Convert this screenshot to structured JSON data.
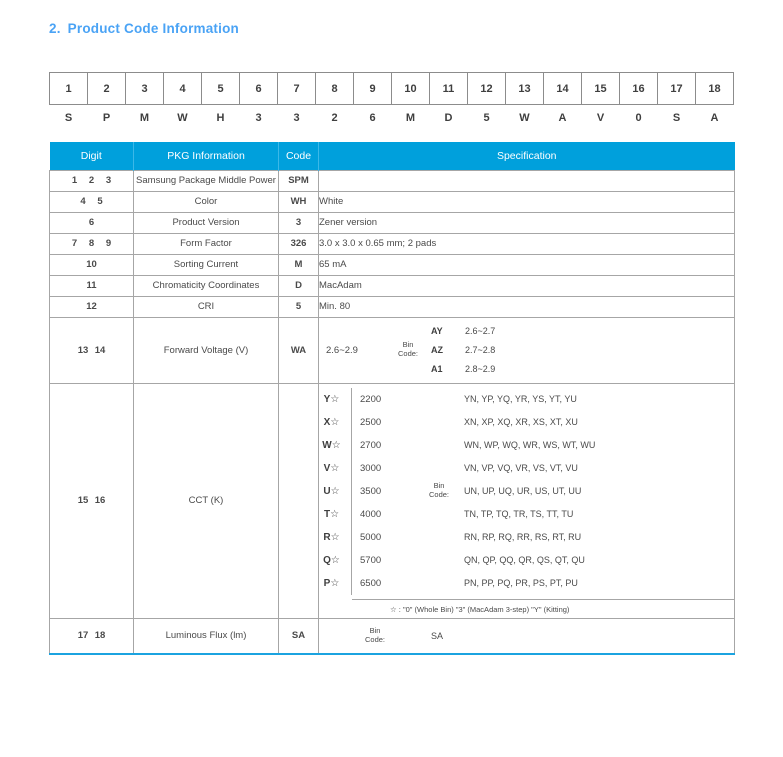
{
  "section": {
    "number": "2.",
    "title": "Product Code Information"
  },
  "code_strip": {
    "positions": [
      "1",
      "2",
      "3",
      "4",
      "5",
      "6",
      "7",
      "8",
      "9",
      "10",
      "11",
      "12",
      "13",
      "14",
      "15",
      "16",
      "17",
      "18"
    ],
    "letters": [
      "S",
      "P",
      "M",
      "W",
      "H",
      "3",
      "3",
      "2",
      "6",
      "M",
      "D",
      "5",
      "W",
      "A",
      "V",
      "0",
      "S",
      "A"
    ]
  },
  "table": {
    "headers": {
      "digit": "Digit",
      "pkg": "PKG Information",
      "code": "Code",
      "specification": "Specification"
    },
    "rows": [
      {
        "digits": [
          "1",
          "2",
          "3"
        ],
        "pkg": "Samsung Package Middle Power",
        "code": "SPM",
        "spec": ""
      },
      {
        "digits": [
          "4",
          "5"
        ],
        "pkg": "Color",
        "code": "WH",
        "spec": "White"
      },
      {
        "digits": [
          "6"
        ],
        "pkg": "Product Version",
        "code": "3",
        "spec": "Zener version"
      },
      {
        "digits": [
          "7",
          "8",
          "9"
        ],
        "pkg": "Form Factor",
        "code": "326",
        "spec": "3.0 x 3.0 x 0.65 mm;   2 pads"
      },
      {
        "digits": [
          "10"
        ],
        "pkg": "Sorting Current",
        "code": "M",
        "spec": "65 mA"
      },
      {
        "digits": [
          "11"
        ],
        "pkg": "Chromaticity Coordinates",
        "code": "D",
        "spec": "MacAdam"
      },
      {
        "digits": [
          "12"
        ],
        "pkg": "CRI",
        "code": "5",
        "spec": "Min. 80"
      }
    ],
    "forward_voltage": {
      "digits": [
        "13",
        "14"
      ],
      "pkg": "Forward Voltage (V)",
      "code": "WA",
      "range": "2.6~2.9",
      "bin_label_line1": "Bin",
      "bin_label_line2": "Code:",
      "bins": [
        {
          "code": "AY",
          "value": "2.6~2.7"
        },
        {
          "code": "AZ",
          "value": "2.7~2.8"
        },
        {
          "code": "A1",
          "value": "2.8~2.9"
        }
      ]
    },
    "cct": {
      "digits": [
        "15",
        "16"
      ],
      "pkg": "CCT (K)",
      "bin_label_line1": "Bin",
      "bin_label_line2": "Code:",
      "star": "☆",
      "rows": [
        {
          "code": "Y",
          "kelvin": "2200",
          "bins": "YN, YP, YQ, YR, YS, YT, YU"
        },
        {
          "code": "X",
          "kelvin": "2500",
          "bins": "XN, XP, XQ, XR, XS, XT, XU"
        },
        {
          "code": "W",
          "kelvin": "2700",
          "bins": "WN, WP, WQ, WR, WS, WT, WU"
        },
        {
          "code": "V",
          "kelvin": "3000",
          "bins": "VN, VP, VQ, VR, VS, VT, VU"
        },
        {
          "code": "U",
          "kelvin": "3500",
          "bins": "UN, UP, UQ, UR, US, UT, UU"
        },
        {
          "code": "T",
          "kelvin": "4000",
          "bins": "TN, TP, TQ, TR, TS, TT, TU"
        },
        {
          "code": "R",
          "kelvin": "5000",
          "bins": "RN, RP, RQ, RR, RS, RT, RU"
        },
        {
          "code": "Q",
          "kelvin": "5700",
          "bins": "QN, QP, QQ, QR, QS, QT, QU"
        },
        {
          "code": "P",
          "kelvin": "6500",
          "bins": "PN, PP, PQ, PR, PS, PT, PU"
        }
      ],
      "note": "☆ : \"0\" (Whole Bin)    \"3\" (MacAdam 3-step)    \"Y\" (Kitting)"
    },
    "luminous_flux": {
      "digits": [
        "17",
        "18"
      ],
      "pkg": "Luminous Flux (lm)",
      "code": "SA",
      "bin_label_line1": "Bin",
      "bin_label_line2": "Code:",
      "bin_value": "SA"
    }
  },
  "colors": {
    "header_bg": "#00a0dc",
    "title": "#4aa3f5",
    "border": "#a6a6a6",
    "accent_bottom": "#1ba3e0"
  }
}
